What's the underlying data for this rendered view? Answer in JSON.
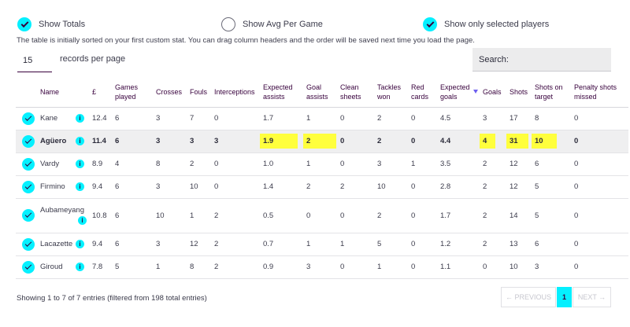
{
  "options": {
    "show_totals": {
      "label": "Show Totals",
      "checked": true
    },
    "show_avg": {
      "label": "Show Avg Per Game",
      "checked": false
    },
    "show_selected": {
      "label": "Show only selected players",
      "checked": true
    }
  },
  "note": "The table is initially sorted on your first custom stat. You can drag column headers and the order will be saved next time you load the page.",
  "records_per_page": {
    "value": "15",
    "label": "records per page"
  },
  "search": {
    "label": "Search:"
  },
  "info_glyph": "i",
  "table": {
    "headers": [
      "",
      "Name",
      "£",
      "Games played",
      "Crosses",
      "Fouls",
      "Interceptions",
      "Expected assists",
      "Goal assists",
      "Clean sheets",
      "Tackles won",
      "Red cards",
      "Expected goals",
      "Goals",
      "Shots",
      "Shots on target",
      "Penalty shots missed"
    ],
    "sort_column": "Expected goals",
    "rows": [
      {
        "name": "Kane",
        "price": "12.4",
        "games": "6",
        "crosses": "3",
        "fouls": "7",
        "interceptions": "0",
        "xa": "1.7",
        "assists": "1",
        "clean": "0",
        "tackles": "2",
        "red": "0",
        "xg": "4.5",
        "goals": "3",
        "shots": "17",
        "sot": "8",
        "pen": "0"
      },
      {
        "name": "Agüero",
        "price": "11.4",
        "games": "6",
        "crosses": "3",
        "fouls": "3",
        "interceptions": "3",
        "xa": "1.9",
        "assists": "2",
        "clean": "0",
        "tackles": "2",
        "red": "0",
        "xg": "4.4",
        "goals": "4",
        "shots": "31",
        "sot": "10",
        "pen": "0"
      },
      {
        "name": "Vardy",
        "price": "8.9",
        "games": "4",
        "crosses": "8",
        "fouls": "2",
        "interceptions": "0",
        "xa": "1.0",
        "assists": "1",
        "clean": "0",
        "tackles": "3",
        "red": "1",
        "xg": "3.5",
        "goals": "2",
        "shots": "12",
        "sot": "6",
        "pen": "0"
      },
      {
        "name": "Firmino",
        "price": "9.4",
        "games": "6",
        "crosses": "3",
        "fouls": "10",
        "interceptions": "0",
        "xa": "1.4",
        "assists": "2",
        "clean": "2",
        "tackles": "10",
        "red": "0",
        "xg": "2.8",
        "goals": "2",
        "shots": "12",
        "sot": "5",
        "pen": "0"
      },
      {
        "name": "Aubameyang",
        "price": "10.8",
        "games": "6",
        "crosses": "10",
        "fouls": "1",
        "interceptions": "2",
        "xa": "0.5",
        "assists": "0",
        "clean": "0",
        "tackles": "2",
        "red": "0",
        "xg": "1.7",
        "goals": "2",
        "shots": "14",
        "sot": "5",
        "pen": "0"
      },
      {
        "name": "Lacazette",
        "price": "9.4",
        "games": "6",
        "crosses": "3",
        "fouls": "12",
        "interceptions": "2",
        "xa": "0.7",
        "assists": "1",
        "clean": "1",
        "tackles": "5",
        "red": "0",
        "xg": "1.2",
        "goals": "2",
        "shots": "13",
        "sot": "6",
        "pen": "0"
      },
      {
        "name": "Giroud",
        "price": "7.8",
        "games": "5",
        "crosses": "1",
        "fouls": "8",
        "interceptions": "2",
        "xa": "0.9",
        "assists": "3",
        "clean": "0",
        "tackles": "1",
        "red": "0",
        "xg": "1.1",
        "goals": "0",
        "shots": "10",
        "sot": "3",
        "pen": "0"
      }
    ]
  },
  "footer": {
    "showing": "Showing 1 to 7 of 7 entries (filtered from 198 total entries)",
    "prev": "← PREVIOUS",
    "current_page": "1",
    "next": "NEXT →"
  },
  "colors": {
    "accent": "#05f0ff",
    "highlight": "#ffff3d",
    "brand": "#37003c",
    "sort_arrow": "#6d5ff0"
  }
}
